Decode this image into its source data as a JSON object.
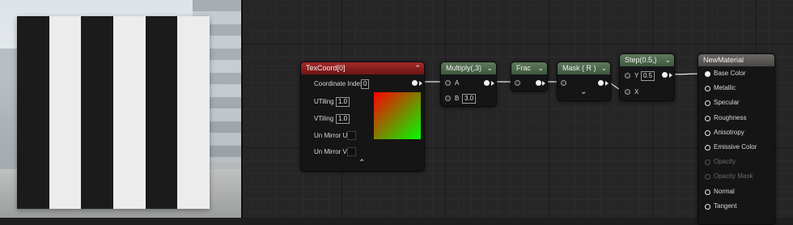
{
  "nodes": {
    "texcoord": {
      "title": "TexCoord[0]",
      "coordinate_index_label": "Coordinate Index",
      "coordinate_index_value": "0",
      "utiling_label": "UTiling",
      "utiling_value": "1.0",
      "vtiling_label": "VTiling",
      "vtiling_value": "1.0",
      "unmirror_u_label": "Un Mirror U",
      "unmirror_v_label": "Un Mirror V",
      "collapse_glyph": "⌃",
      "header_color": "#8e2222"
    },
    "multiply": {
      "title": "Multiply(,3)",
      "pin_a": "A",
      "pin_b": "B",
      "b_value": "3.0",
      "header_color": "#4f6a4d"
    },
    "frac": {
      "title": "Frac",
      "header_color": "#4f6a4d"
    },
    "mask": {
      "title": "Mask ( R )",
      "expand_glyph": "⌄",
      "header_color": "#4f6a4d"
    },
    "step": {
      "title": "Step(0.5,)",
      "pin_y": "Y",
      "y_value": "0.5",
      "pin_x": "X",
      "header_color": "#4f6a4d"
    },
    "material": {
      "title": "NewMaterial",
      "header_color": "#5a5754",
      "inputs": [
        {
          "label": "Base Color",
          "enabled": true
        },
        {
          "label": "Metallic",
          "enabled": true
        },
        {
          "label": "Specular",
          "enabled": true
        },
        {
          "label": "Roughness",
          "enabled": true
        },
        {
          "label": "Anisotropy",
          "enabled": true
        },
        {
          "label": "Emissive Color",
          "enabled": true
        },
        {
          "label": "Opacity",
          "enabled": false
        },
        {
          "label": "Opacity Mask",
          "enabled": false
        },
        {
          "label": "Normal",
          "enabled": true
        },
        {
          "label": "Tangent",
          "enabled": true
        }
      ]
    }
  },
  "chevron_glyph": "⌄"
}
